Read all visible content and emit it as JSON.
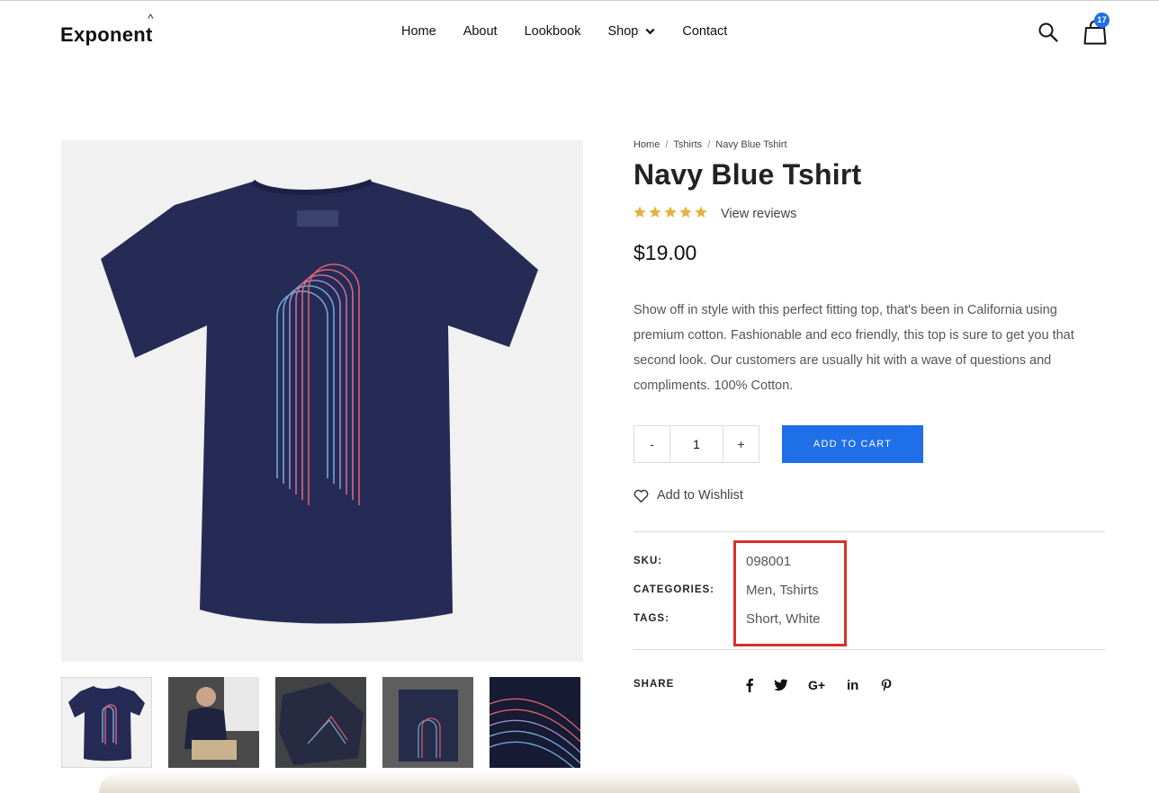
{
  "brand": {
    "name": "Exponent",
    "mark": "^"
  },
  "nav": {
    "items": [
      "Home",
      "About",
      "Lookbook",
      "Shop",
      "Contact"
    ]
  },
  "header": {
    "cart_count": "17"
  },
  "breadcrumb": {
    "items": [
      "Home",
      "Tshirts",
      "Navy Blue Tshirt"
    ],
    "separator": "/"
  },
  "product": {
    "title": "Navy Blue Tshirt",
    "rating": 5,
    "rating_max": 5,
    "reviews_link": "View reviews",
    "price": "$19.00",
    "description": "Show off in style with this perfect fitting top, that's been in California using premium cotton. Fashionable and eco friendly, this top is sure to get you that second look. Our customers are usually hit with a wave of questions and compliments. 100% Cotton.",
    "quantity": "1",
    "minus": "-",
    "plus": "+",
    "add_to_cart": "ADD TO CART",
    "wishlist": "Add to Wishlist"
  },
  "meta": {
    "sku_label": "SKU:",
    "sku": "098001",
    "categories_label": "CATEGORIES:",
    "categories": "Men, Tshirts",
    "tags_label": "TAGS:",
    "tags": "Short, White"
  },
  "share": {
    "label": "SHARE",
    "icons": [
      "facebook-icon",
      "twitter-icon",
      "google-plus-icon",
      "linkedin-icon",
      "pinterest-icon"
    ],
    "gplus_text": "G+",
    "linkedin_text": "in"
  },
  "colors": {
    "accent": "#1e6fe8",
    "highlight_box": "#d8302a",
    "shirt": "#262b55",
    "star": "#e3b341"
  }
}
